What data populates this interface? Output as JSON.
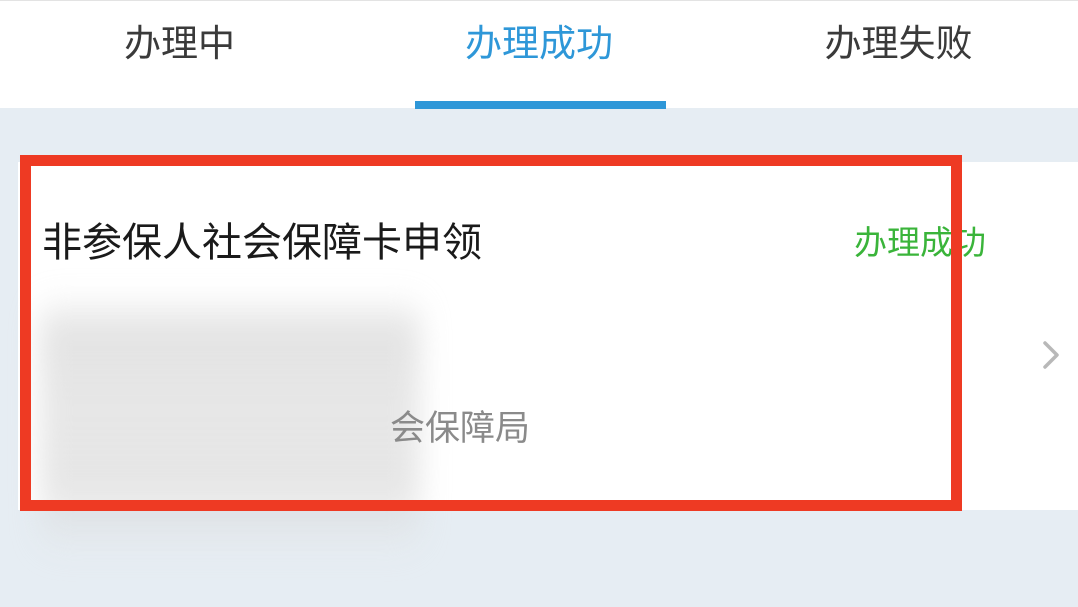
{
  "tabs": [
    {
      "label": "办理中",
      "active": false
    },
    {
      "label": "办理成功",
      "active": true
    },
    {
      "label": "办理失败",
      "active": false
    }
  ],
  "card": {
    "title": "非参保人社会保障卡申领",
    "status": "办理成功",
    "organization_visible": "会保障局"
  },
  "icons": {
    "chevron": "chevron-right-icon"
  },
  "colors": {
    "accent": "#2e97d8",
    "success": "#3ab43a",
    "highlight": "#ee3a23",
    "background": "#e6edf3"
  }
}
